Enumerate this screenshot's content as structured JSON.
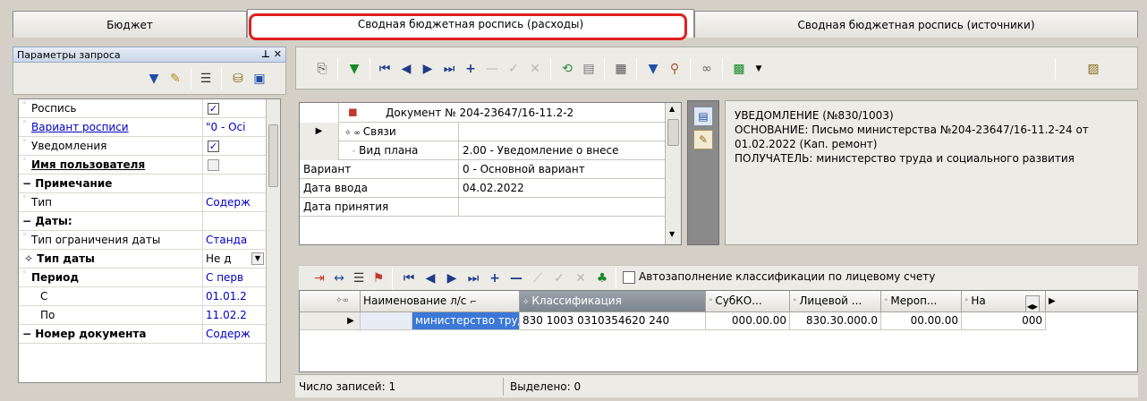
{
  "tabs": [
    {
      "label": "Бюджет"
    },
    {
      "label": "Сводная бюджетная роспись (расходы)"
    },
    {
      "label": "Сводная бюджетная роспись (источники)"
    }
  ],
  "query_panel": {
    "title": "Параметры запроса",
    "pin": "⊥ ✕",
    "rows": [
      {
        "name": "Роспись",
        "value": "",
        "checked": true
      },
      {
        "name": "Вариант росписи",
        "value": "\"0 - Осі"
      },
      {
        "name": "Уведомления",
        "value": "",
        "checked": true
      },
      {
        "name": "Имя пользователя",
        "value": "",
        "checked": false
      },
      {
        "name": "− Примечание",
        "value": ""
      },
      {
        "name": "Тип",
        "value": "Содерж"
      },
      {
        "name": "− Даты:",
        "value": ""
      },
      {
        "name": "Тип ограничения даты",
        "value": "Станда"
      },
      {
        "name": "✧ Тип даты",
        "value": "Не д"
      },
      {
        "name": "Период",
        "value": "С перв"
      },
      {
        "name": "С",
        "value": "01.01.2"
      },
      {
        "name": "По",
        "value": "11.02.2"
      },
      {
        "name": "− Номер документа",
        "value": "Содерж"
      }
    ]
  },
  "document": {
    "header": "Документ № 204-23647/16-11.2-2",
    "rows": [
      {
        "label": "Связи",
        "value": ""
      },
      {
        "label": "Вид плана",
        "value": "2.00 - Уведомление о внесе"
      },
      {
        "label": "Вариант",
        "value": "0 - Основной вариант"
      },
      {
        "label": "Дата ввода",
        "value": "04.02.2022"
      },
      {
        "label": "Дата принятия",
        "value": ""
      }
    ]
  },
  "notice": "УВЕДОМЛЕНИЕ  (№830/1003)\nОСНОВАНИЕ: Письмо министерства №204-23647/16-11.2-24 от 01.02.2022 (Кап. ремонт)\nПОЛУЧАТЕЛЬ:  министерство труда и социального развития",
  "autofill_label": "Автозаполнение классификации по лицевому счету",
  "lines": {
    "headers": [
      "Наименование л/с",
      "Классификация",
      "СубКО...",
      "Лицевой ...",
      "Мероп...",
      "На"
    ],
    "rows": [
      [
        "министерство труда и",
        "830 1003 0310354620 240",
        "000.00.00",
        "830.30.000.0",
        "00.00.00",
        "000"
      ]
    ]
  },
  "status": {
    "count": "Число записей: 1",
    "selected": "Выделено: 0"
  }
}
